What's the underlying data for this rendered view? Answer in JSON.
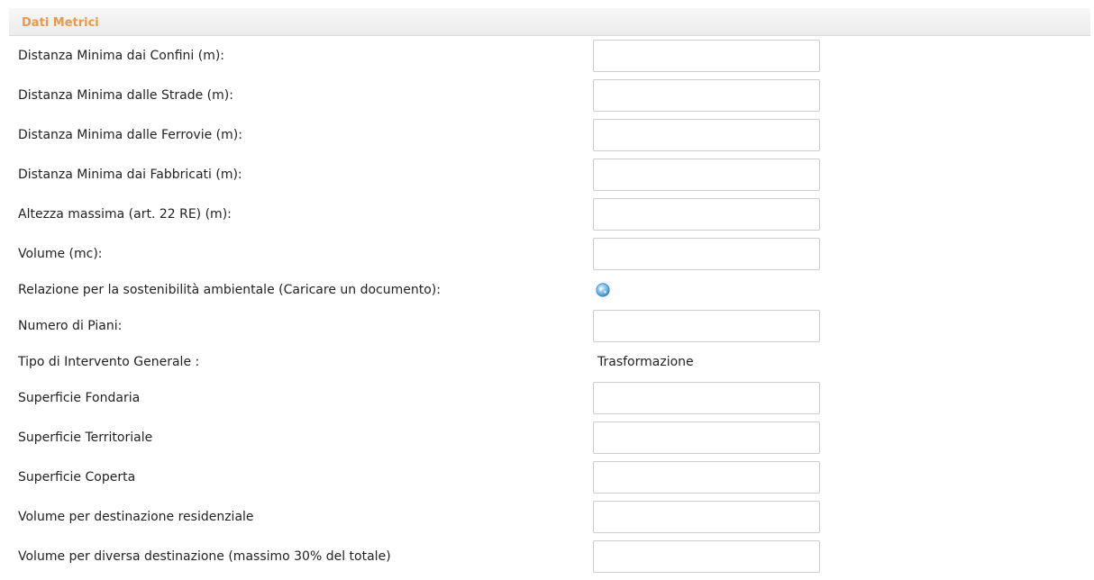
{
  "section": {
    "title": "Dati Metrici"
  },
  "rows": [
    {
      "label": "Distanza Minima dai Confini (m):",
      "value": ""
    },
    {
      "label": "Distanza Minima dalle Strade (m):",
      "value": ""
    },
    {
      "label": "Distanza Minima dalle Ferrovie (m):",
      "value": ""
    },
    {
      "label": "Distanza Minima dai Fabbricati (m):",
      "value": ""
    },
    {
      "label": "Altezza massima (art. 22 RE) (m):",
      "value": ""
    },
    {
      "label": "Volume (mc):",
      "value": ""
    },
    {
      "label": "Relazione per la sostenibilità ambientale (Caricare un documento):",
      "icon": "globe-upload-icon"
    },
    {
      "label": "Numero di Piani:",
      "value": ""
    },
    {
      "label": "Tipo di Intervento Generale :",
      "static_value": "Trasformazione"
    },
    {
      "label": "Superficie Fondaria",
      "value": ""
    },
    {
      "label": "Superficie Territoriale",
      "value": ""
    },
    {
      "label": "Superficie Coperta",
      "value": ""
    },
    {
      "label": "Volume per destinazione residenziale",
      "value": ""
    },
    {
      "label": "Volume per diversa destinazione (massimo 30% del totale)",
      "value": ""
    }
  ],
  "colors": {
    "section_title": "#e79a4e",
    "header_background": "#efefef",
    "input_border": "#cccccc"
  }
}
